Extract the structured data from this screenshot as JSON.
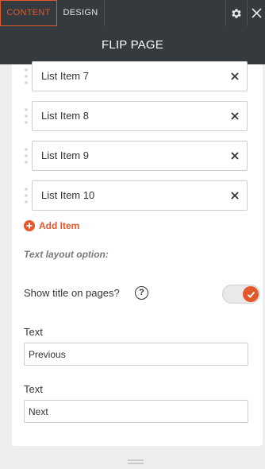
{
  "tabs": {
    "content": "CONTENT",
    "design": "DESIGN"
  },
  "header": {
    "title": "FLIP PAGE"
  },
  "list_items": [
    "List Item 7",
    "List Item 8",
    "List Item 9",
    "List Item 10"
  ],
  "add_item_label": "Add Item",
  "section_title": "Text layout option:",
  "show_title": {
    "label": "Show title on pages?",
    "help": "?",
    "enabled": true
  },
  "fields": [
    {
      "label": "Text",
      "value": "Previous"
    },
    {
      "label": "Text",
      "value": "Next"
    }
  ],
  "colors": {
    "accent": "#e2582b",
    "header_bg": "#343a3e",
    "panel_bg": "#ffffff",
    "page_bg": "#eeeeee"
  },
  "icons": [
    "gear-icon",
    "close-icon",
    "drag-handle-icon",
    "remove-icon",
    "plus-circle-icon",
    "help-icon",
    "check-icon",
    "resize-handle-icon"
  ]
}
